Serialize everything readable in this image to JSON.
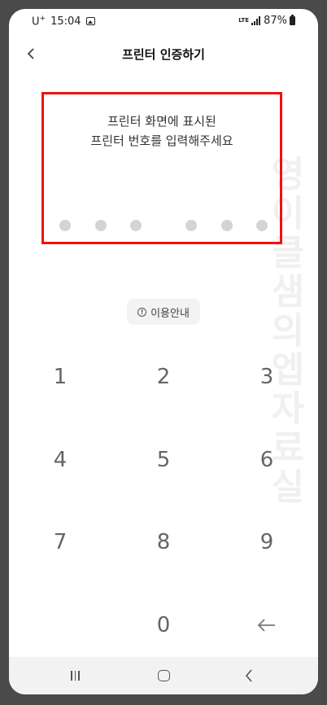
{
  "status": {
    "carrier": "U",
    "carrier_sup": "+",
    "time": "15:04",
    "network": "LTE",
    "battery": "87%"
  },
  "header": {
    "title": "프린터 인증하기",
    "back_icon": "chevron-left-icon"
  },
  "instruction": {
    "line1": "프린터 화면에 표시된",
    "line2": "프린터 번호를 입력해주세요"
  },
  "pin": {
    "length": 6,
    "filled": 0
  },
  "watermark": "영이클샘의엡자료실",
  "guide": {
    "icon": "info-icon",
    "icon_glyph": "!",
    "label": "이용안내"
  },
  "keypad": {
    "keys": [
      "1",
      "2",
      "3",
      "4",
      "5",
      "6",
      "7",
      "8",
      "9",
      "0"
    ],
    "backspace_icon": "arrow-left-icon"
  },
  "colors": {
    "highlight": "#ee1111",
    "dot": "#d4d4d4",
    "key_text": "#666666"
  }
}
